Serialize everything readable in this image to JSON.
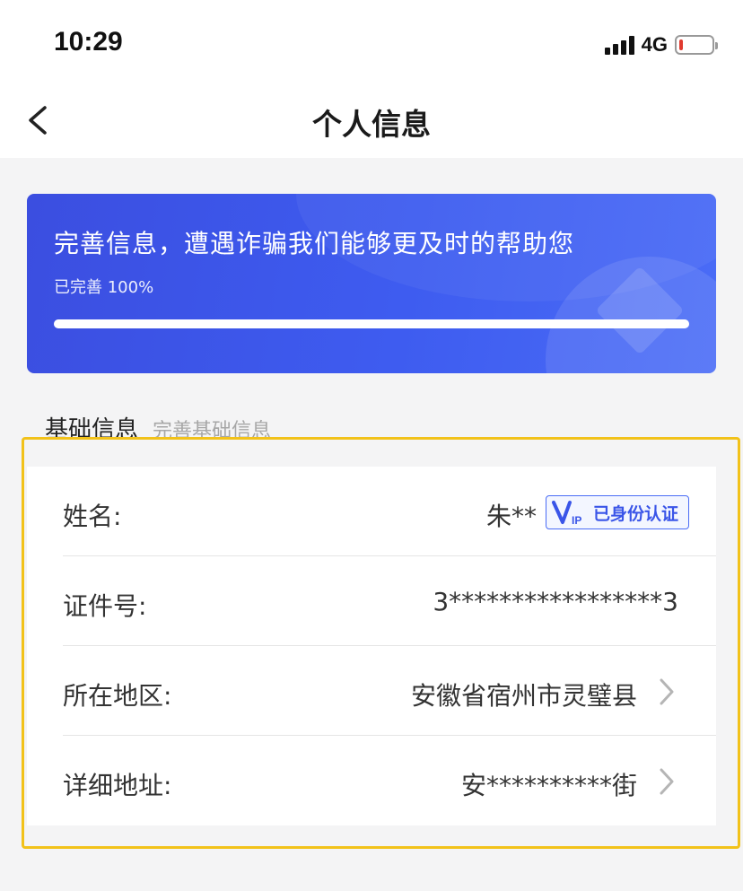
{
  "status_bar": {
    "time": "10:29",
    "network": "4G",
    "battery_level": 0.1
  },
  "nav": {
    "title": "个人信息",
    "back_icon": "chevron-left-icon"
  },
  "banner": {
    "title": "完善信息，遭遇诈骗我们能够更及时的帮助您",
    "progress_text": "已完善 100%",
    "progress": 1.0
  },
  "section": {
    "title": "基础信息",
    "subtitle": "完善基础信息"
  },
  "rows": [
    {
      "label": "姓名:",
      "value": "朱**",
      "badge": "已身份认证"
    },
    {
      "label": "证件号:",
      "value": "3*****************3"
    },
    {
      "label": "所在地区:",
      "value": "安徽省宿州市灵璧县"
    },
    {
      "label": "详细地址:",
      "value": "安**********街"
    }
  ],
  "colors": {
    "accent": "#3e5cf0",
    "highlight": "#f2c21a"
  }
}
